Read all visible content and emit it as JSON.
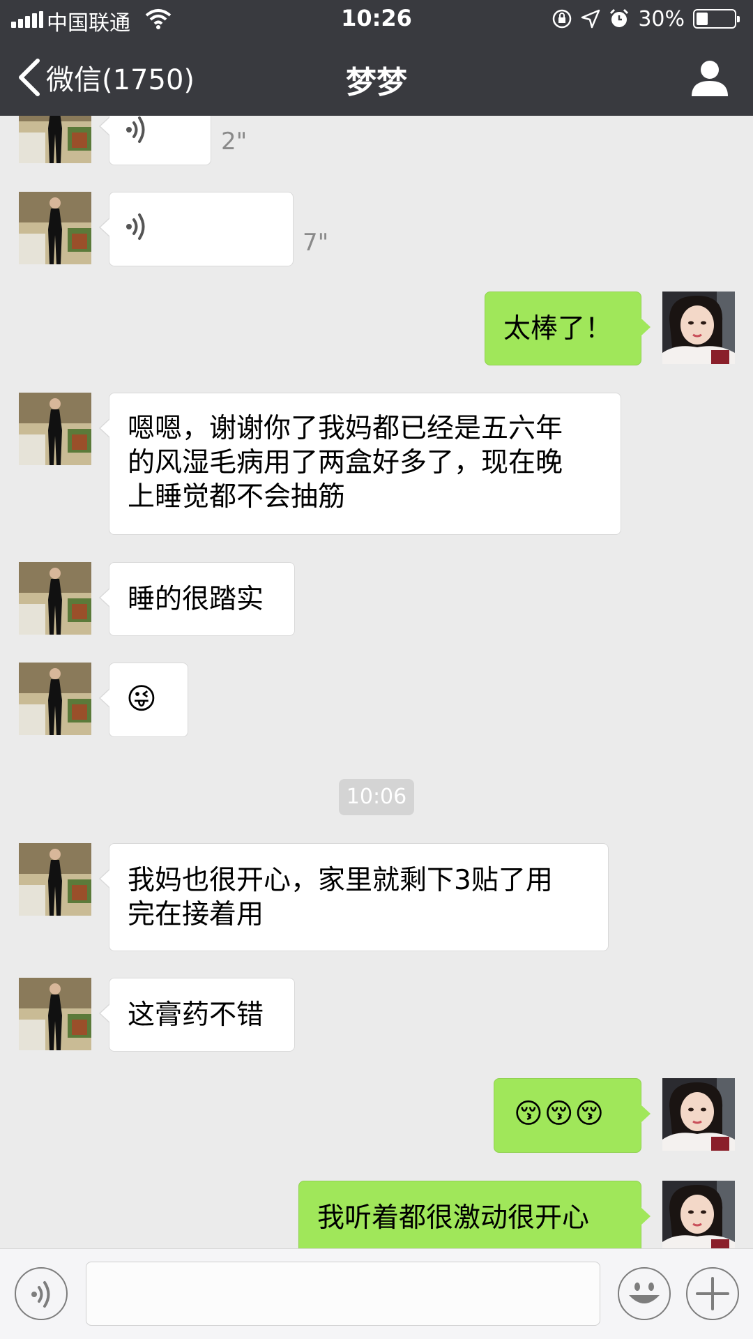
{
  "status_bar": {
    "carrier": "中国联通",
    "time": "10:26",
    "battery_percent": "30%",
    "battery_level": 0.3,
    "icons": [
      "signal-icon",
      "wifi-icon",
      "orientation-lock-icon",
      "location-icon",
      "alarm-icon",
      "battery-icon"
    ]
  },
  "nav": {
    "back_label": "微信(1750)",
    "title": "梦梦",
    "back_icon": "chevron-left-icon",
    "profile_icon": "person-icon"
  },
  "messages": [
    {
      "from": "contact",
      "type": "voice",
      "duration": "2\""
    },
    {
      "from": "contact",
      "type": "voice",
      "duration": "7\""
    },
    {
      "from": "me",
      "type": "text",
      "text": "太棒了！"
    },
    {
      "from": "contact",
      "type": "text",
      "lines": [
        "嗯嗯，谢谢你了我妈都已经是五六年",
        "的风湿毛病用了两盒好多了，现在晚",
        "上睡觉都不会抽筋"
      ]
    },
    {
      "from": "contact",
      "type": "text",
      "text": "睡的很踏实"
    },
    {
      "from": "contact",
      "type": "emoji",
      "text": "😜"
    },
    {
      "from": "contact",
      "type": "text",
      "lines": [
        "我妈也很开心，家里就剩下3贴了用",
        "完在接着用"
      ]
    },
    {
      "from": "contact",
      "type": "text",
      "text": "这膏药不错"
    },
    {
      "from": "me",
      "type": "emoji",
      "text": "😚😚😚"
    },
    {
      "from": "me",
      "type": "text",
      "text": "我听着都很激动很开心"
    }
  ],
  "timestamp": "10:06",
  "input_bar": {
    "voice_icon": "voice-toggle-icon",
    "emoji_icon": "emoji-face-icon",
    "plus_icon": "plus-icon",
    "message_value": ""
  },
  "colors": {
    "nav_bg": "#393a3f",
    "chat_bg": "#ebebeb",
    "outgoing_bubble": "#a0e75a",
    "incoming_bubble": "#ffffff"
  }
}
